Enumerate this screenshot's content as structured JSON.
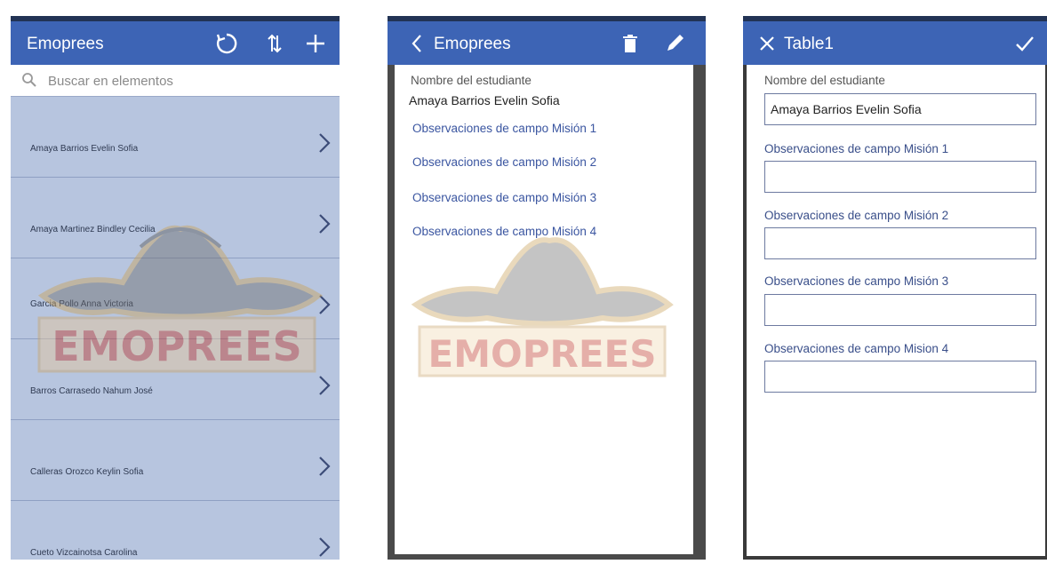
{
  "list_screen": {
    "title": "Emoprees",
    "search_placeholder": "Buscar en elementos",
    "items": [
      "Amaya Barrios Evelin Sofia",
      "Amaya Martinez Bindley Cecilia",
      "Garcia Pollo Anna Victoria",
      "Barros Carrasedo Nahum José",
      "Calleras Orozco Keylin Sofia",
      "Cueto Vizcainotsa Carolina"
    ],
    "icons": [
      "refresh-icon",
      "sort-icon",
      "add-icon",
      "search-icon",
      "chevron-right-icon"
    ]
  },
  "detail_screen": {
    "title": "Emoprees",
    "student_label": "Nombre del estudiante",
    "student_value": "Amaya Barrios Evelin Sofia",
    "fields": [
      "Observaciones de campo Misión 1",
      "Observaciones de campo Misión 2",
      "Observaciones de campo Misión 3",
      "Observaciones de campo Misión 4"
    ],
    "icons": [
      "back-icon",
      "delete-icon",
      "edit-icon"
    ]
  },
  "edit_screen": {
    "title": "Table1",
    "student_label": "Nombre del estudiante",
    "student_value": "Amaya Barrios Evelin Sofia",
    "fields": [
      {
        "label": "Observaciones de campo Misión 1",
        "value": ""
      },
      {
        "label": "Observaciones de campo Misión 2",
        "value": ""
      },
      {
        "label": "Observaciones de campo Misión 3",
        "value": ""
      },
      {
        "label": "Observaciones de campo Mision 4",
        "value": ""
      }
    ],
    "icons": [
      "close-icon",
      "check-icon"
    ]
  },
  "watermark": {
    "text": "EMOPREES"
  },
  "colors": {
    "header": "#3d64b5",
    "list_bg": "#b7c5df",
    "watermark_red": "#c0392b",
    "watermark_gold": "#d8b06a"
  }
}
